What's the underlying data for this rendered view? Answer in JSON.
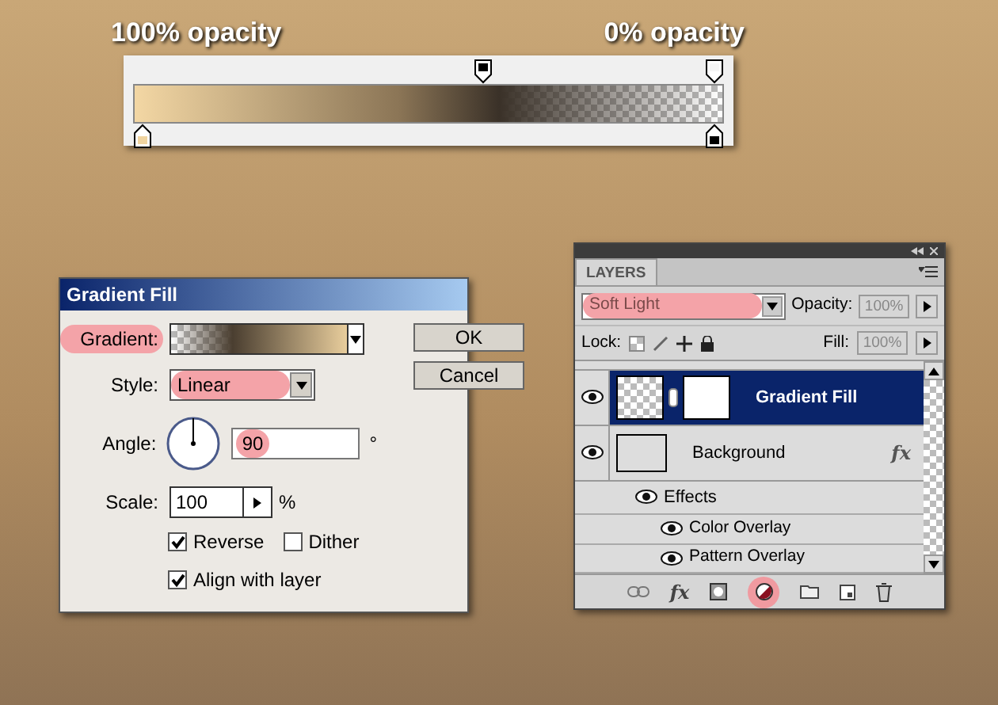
{
  "gradient_editor": {
    "left_label": "100% opacity",
    "right_label": "0% opacity"
  },
  "gradient_dialog": {
    "title": "Gradient Fill",
    "gradient_label": {
      "text": "Gradient:",
      "highlighted": true
    },
    "style": {
      "label": "Style:",
      "value": "Linear",
      "highlighted": true
    },
    "angle": {
      "label": "Angle:",
      "value": "90",
      "unit": "°",
      "highlighted": true
    },
    "scale": {
      "label": "Scale:",
      "value": "100",
      "unit": "%"
    },
    "checkboxes": [
      {
        "label": "Reverse",
        "checked": true
      },
      {
        "label": "Dither",
        "checked": false
      },
      {
        "label": "Align with layer",
        "checked": true
      }
    ],
    "buttons": [
      "OK",
      "Cancel"
    ]
  },
  "layers_panel": {
    "tab": "LAYERS",
    "blend_mode": {
      "value": "Soft Light",
      "highlighted": true
    },
    "opacity": {
      "label": "Opacity:",
      "value": "100%",
      "disabled": true
    },
    "lock_label": "Lock:",
    "fill": {
      "label": "Fill:",
      "value": "100%",
      "disabled": true
    },
    "layers": [
      {
        "name": "Gradient Fill",
        "kind": "fill",
        "selected": true,
        "visible": true
      },
      {
        "name": "Background",
        "kind": "layer",
        "selected": false,
        "visible": true,
        "fx": "fx",
        "children": [
          {
            "name": "Effects",
            "kind": "effects",
            "visible": true,
            "children": [
              {
                "name": "Color Overlay",
                "kind": "effect",
                "visible": true
              },
              {
                "name": "Pattern Overlay",
                "kind": "effect",
                "visible": true
              }
            ]
          }
        ]
      }
    ],
    "toolbar": {
      "fx": "fx",
      "adjustment_highlighted": true
    }
  }
}
